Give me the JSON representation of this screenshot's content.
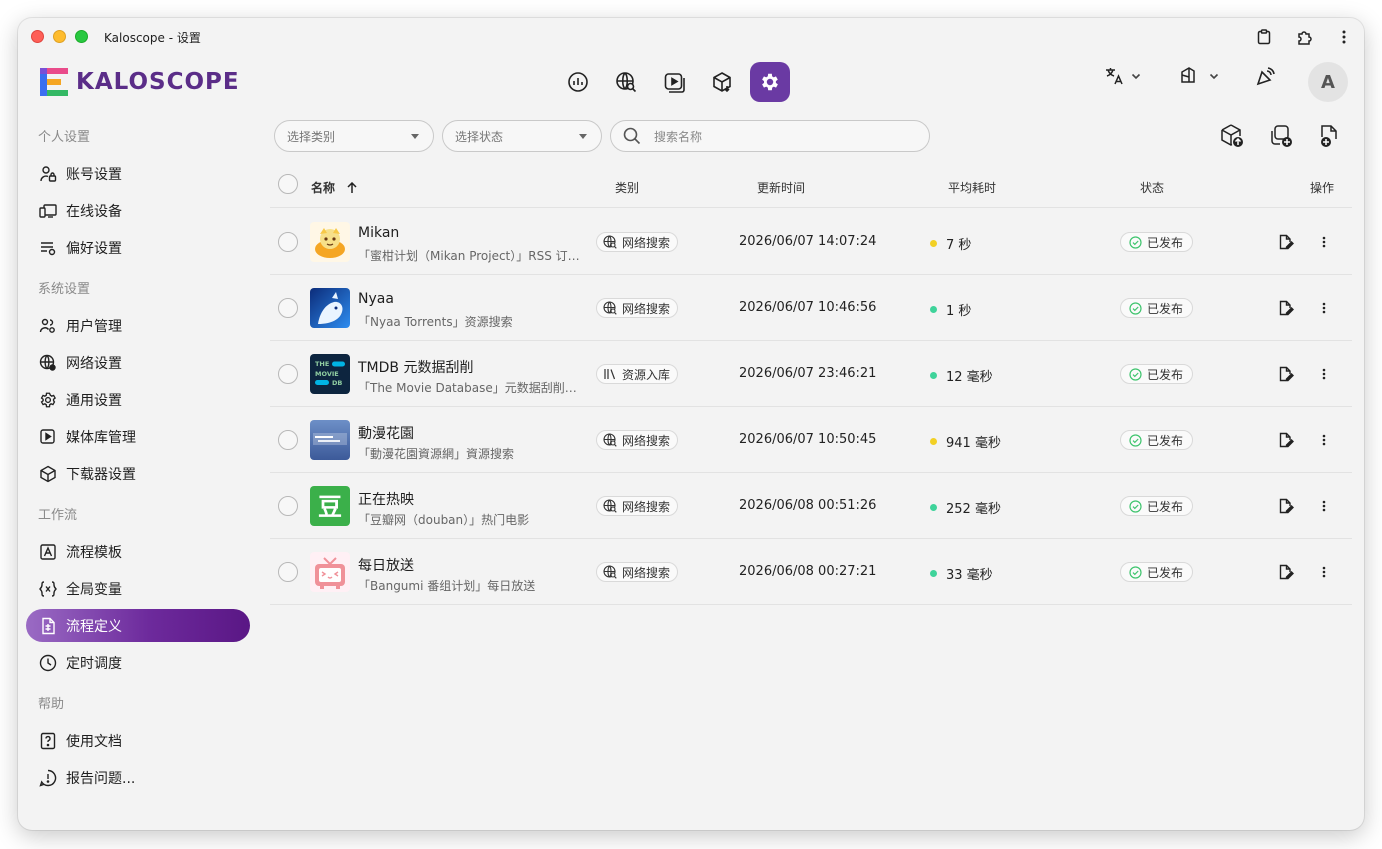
{
  "window": {
    "title": "Kaloscope - 设置"
  },
  "header": {
    "logo_text": "KALOSCOPE",
    "nav": [
      {
        "icon": "chart-bars-icon"
      },
      {
        "icon": "globe-search-icon"
      },
      {
        "icon": "media-player-icon"
      },
      {
        "icon": "package-download-icon"
      },
      {
        "icon": "gear-icon",
        "active": true
      }
    ],
    "avatar_letter": "A",
    "accent_color": "#6a3aa3"
  },
  "sidebar": {
    "sections": [
      {
        "title": "个人设置",
        "items": [
          {
            "label": "账号设置",
            "icon": "user-lock-icon"
          },
          {
            "label": "在线设备",
            "icon": "devices-icon"
          },
          {
            "label": "偏好设置",
            "icon": "list-settings-icon"
          }
        ]
      },
      {
        "title": "系统设置",
        "items": [
          {
            "label": "用户管理",
            "icon": "users-settings-icon"
          },
          {
            "label": "网络设置",
            "icon": "globe-settings-icon"
          },
          {
            "label": "通用设置",
            "icon": "gear-icon"
          },
          {
            "label": "媒体库管理",
            "icon": "media-library-icon"
          },
          {
            "label": "下载器设置",
            "icon": "package-icon"
          }
        ]
      },
      {
        "title": "工作流",
        "items": [
          {
            "label": "流程模板",
            "icon": "template-icon"
          },
          {
            "label": "全局变量",
            "icon": "variable-icon"
          },
          {
            "label": "流程定义",
            "icon": "flow-definition-icon",
            "active": true
          },
          {
            "label": "定时调度",
            "icon": "clock-icon"
          }
        ]
      },
      {
        "title": "帮助",
        "items": [
          {
            "label": "使用文档",
            "icon": "help-doc-icon"
          },
          {
            "label": "报告问题...",
            "icon": "report-issue-icon"
          }
        ]
      }
    ]
  },
  "toolbar": {
    "category_placeholder": "选择类别",
    "status_placeholder": "选择状态",
    "search_placeholder": "搜索名称"
  },
  "table": {
    "headers": {
      "name": "名称",
      "category": "类别",
      "updated": "更新时间",
      "avg_time": "平均耗时",
      "status": "状态",
      "actions": "操作"
    },
    "rows": [
      {
        "name": "Mikan",
        "desc": "「蜜柑计划（Mikan Project）」RSS 订阅...",
        "category": "网络搜索",
        "category_icon": "globe-search-icon",
        "updated": "2026/06/07 14:07:24",
        "avg_time": "7 秒",
        "dot_color": "#f2d024",
        "status": "已发布",
        "thumb": "mikan"
      },
      {
        "name": "Nyaa",
        "desc": "「Nyaa Torrents」资源搜索",
        "category": "网络搜索",
        "category_icon": "globe-search-icon",
        "updated": "2026/06/07 10:46:56",
        "avg_time": "1 秒",
        "dot_color": "#3ed39a",
        "status": "已发布",
        "thumb": "nyaa"
      },
      {
        "name": "TMDB 元数据刮削",
        "desc": "「The Movie Database」元数据刮削（...",
        "category": "资源入库",
        "category_icon": "library-icon",
        "updated": "2026/06/07 23:46:21",
        "avg_time": "12 毫秒",
        "dot_color": "#3ed39a",
        "status": "已发布",
        "thumb": "tmdb"
      },
      {
        "name": "動漫花園",
        "desc": "「動漫花園資源網」資源搜索",
        "category": "网络搜索",
        "category_icon": "globe-search-icon",
        "updated": "2026/06/07 10:50:45",
        "avg_time": "941 毫秒",
        "dot_color": "#f2d024",
        "status": "已发布",
        "thumb": "dmhy"
      },
      {
        "name": "正在热映",
        "desc": "「豆瓣网（douban）」热门电影",
        "category": "网络搜索",
        "category_icon": "globe-search-icon",
        "updated": "2026/06/08 00:51:26",
        "avg_time": "252 毫秒",
        "dot_color": "#3ed39a",
        "status": "已发布",
        "thumb": "douban",
        "thumb_text": "豆"
      },
      {
        "name": "每日放送",
        "desc": "「Bangumi 番组计划」每日放送",
        "category": "网络搜索",
        "category_icon": "globe-search-icon",
        "updated": "2026/06/08 00:27:21",
        "avg_time": "33 毫秒",
        "dot_color": "#3ed39a",
        "status": "已发布",
        "thumb": "bangumi"
      }
    ]
  }
}
